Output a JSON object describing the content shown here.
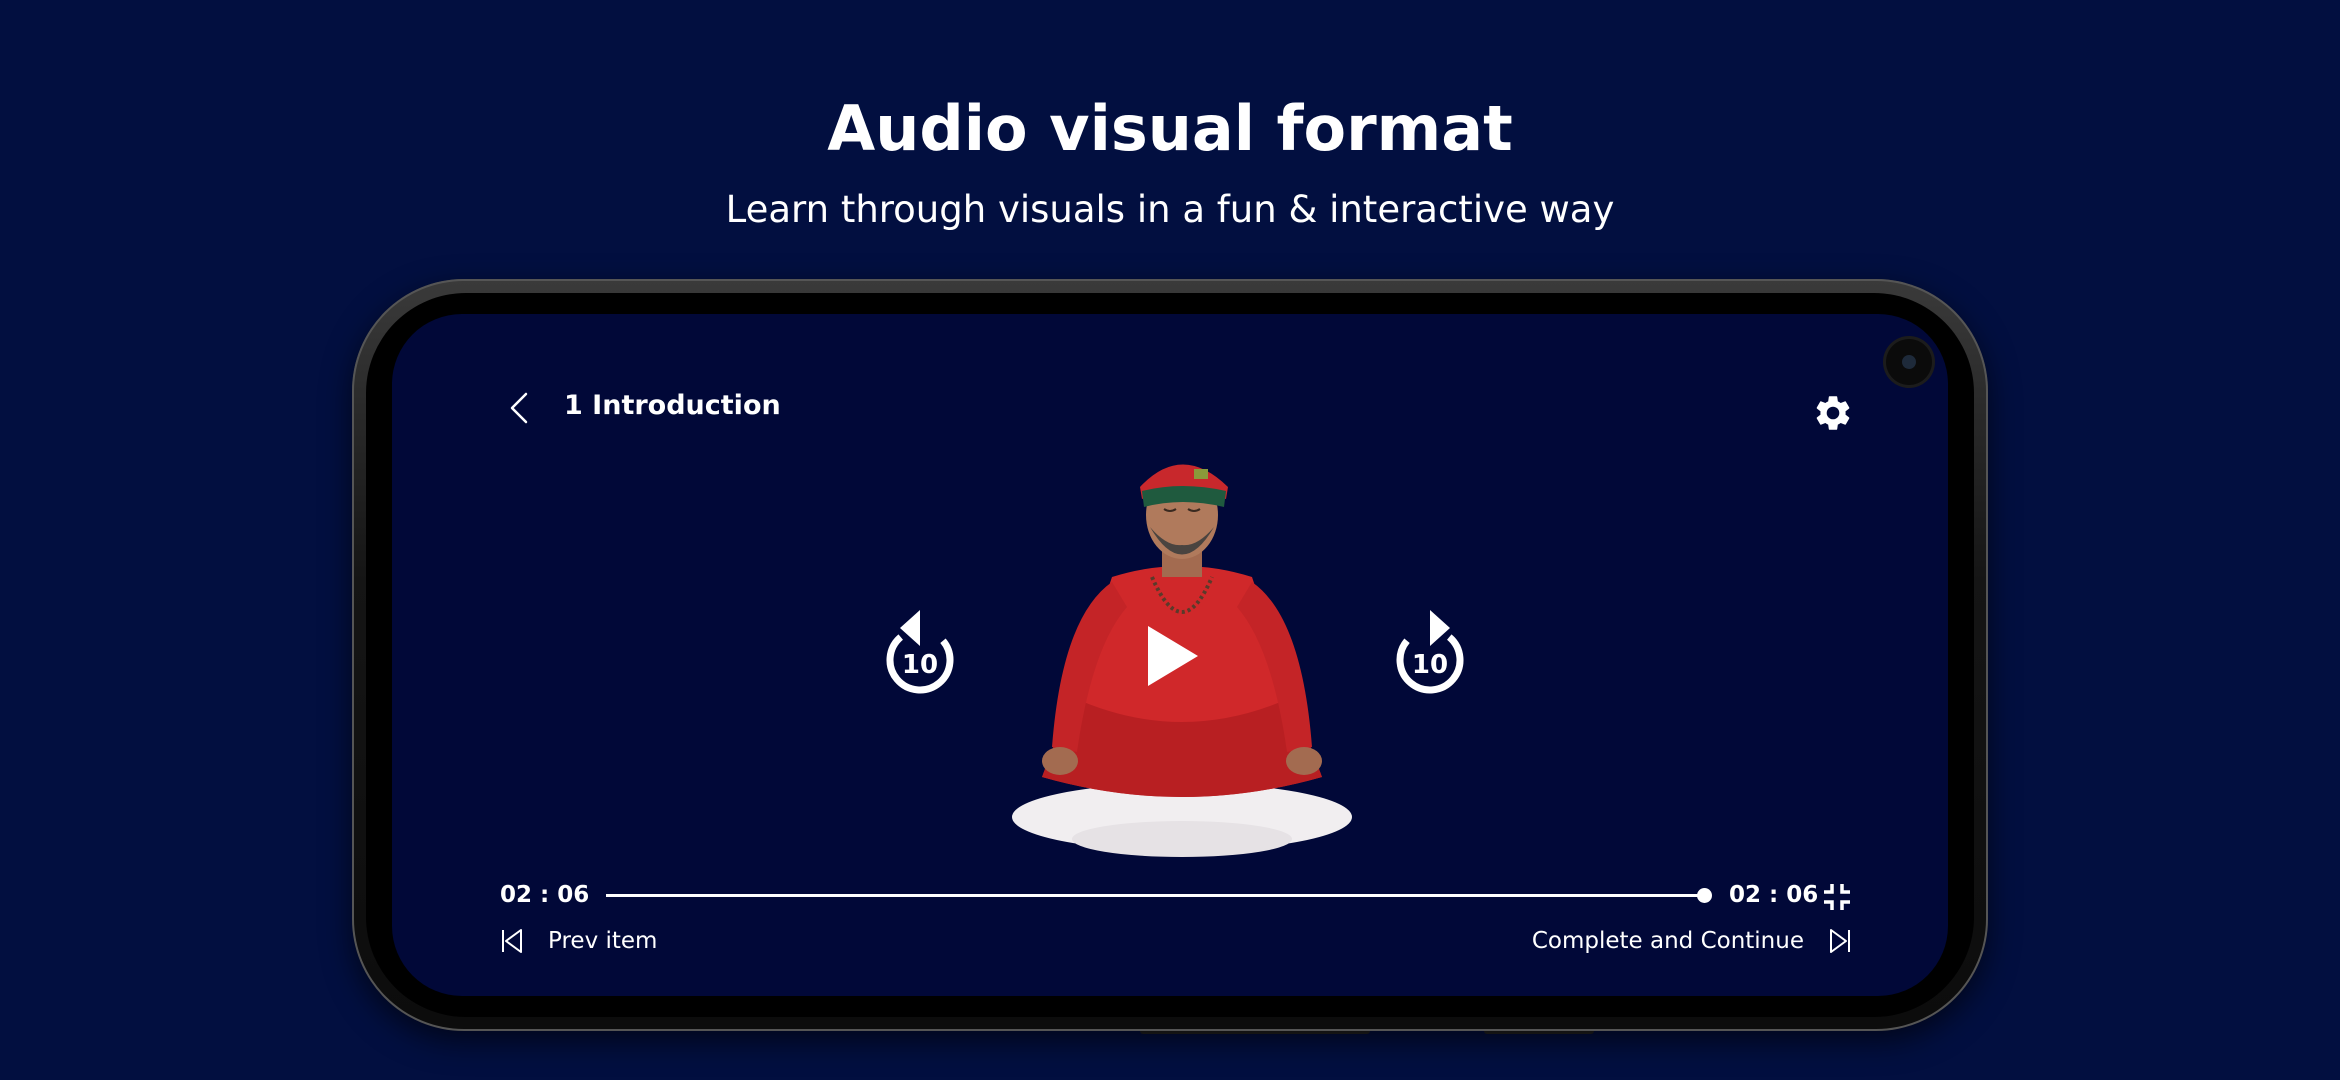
{
  "promo": {
    "headline": "Audio visual format",
    "subheadline": "Learn through visuals in a fun & interactive way"
  },
  "player": {
    "title": "1 Introduction",
    "skip_back_seconds": "10",
    "skip_forward_seconds": "10",
    "current_time": "02 : 06",
    "total_time": "02 : 06",
    "progress": 1.0,
    "prev_label": "Prev item",
    "next_label": "Complete and Continue"
  },
  "colors": {
    "background": "#020f40",
    "screen": "#010838",
    "accent": "#ffffff"
  },
  "icons": {
    "back": "chevron-left-icon",
    "settings": "gear-icon",
    "play": "play-icon",
    "rewind": "rewind-10-icon",
    "forward": "forward-10-icon",
    "minimize": "exit-fullscreen-icon",
    "prev": "skip-previous-icon",
    "next": "skip-next-icon"
  }
}
